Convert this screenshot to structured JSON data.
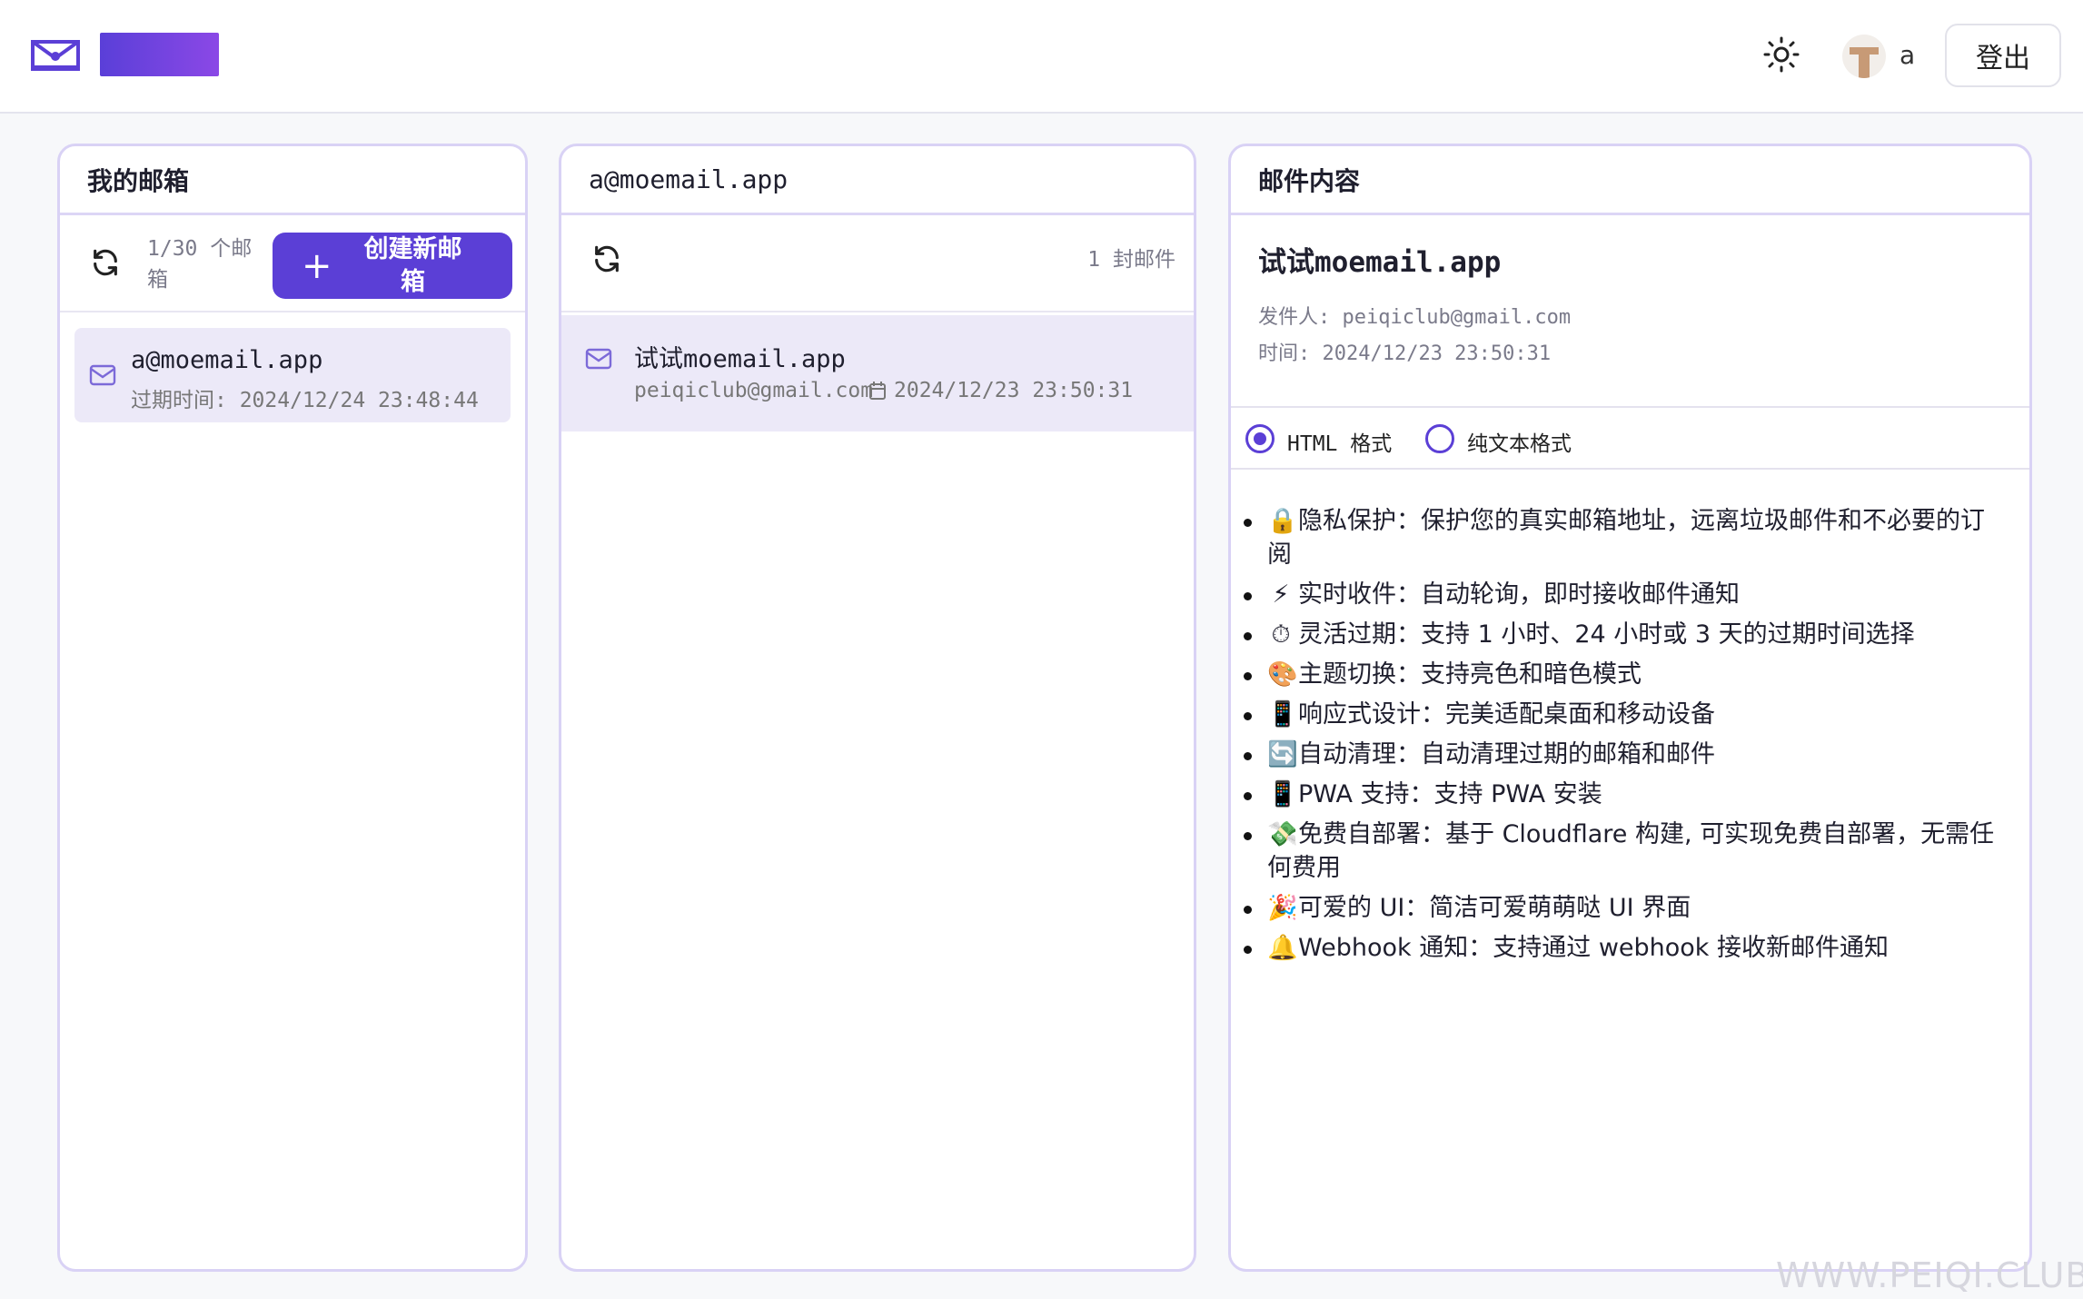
{
  "header": {
    "user_name": "a",
    "logout_label": "登出"
  },
  "mailboxes_panel": {
    "title": "我的邮箱",
    "count_text": "1/30 个邮箱",
    "create_button_label": "创建新邮箱",
    "items": [
      {
        "address": "a@moemail.app",
        "expires": "过期时间: 2024/12/24 23:48:44"
      }
    ]
  },
  "messages_panel": {
    "title": "a@moemail.app",
    "count_text": "1 封邮件",
    "items": [
      {
        "subject": "试试moemail.app",
        "from": "peiqiclub@gmail.com",
        "time": "2024/12/23 23:50:31"
      }
    ]
  },
  "content_panel": {
    "title": "邮件内容",
    "subject": "试试moemail.app",
    "from_line": "发件人: peiqiclub@gmail.com",
    "time_line": "时间: 2024/12/23 23:50:31",
    "format_html_label": "HTML 格式",
    "format_text_label": "纯文本格式",
    "selected_format": "HTML 格式",
    "features": [
      {
        "icon": "lock-icon",
        "emoji": "🔒",
        "text": "隐私保护：保护您的真实邮箱地址，远离垃圾邮件和不必要的订阅"
      },
      {
        "icon": "lightning-icon",
        "emoji": "⚡",
        "text": "实时收件：自动轮询，即时接收邮件通知"
      },
      {
        "icon": "stopwatch-icon",
        "emoji": "⏱",
        "text": "灵活过期：支持 1 小时、24 小时或 3 天的过期时间选择"
      },
      {
        "icon": "palette-icon",
        "emoji": "🎨",
        "text": "主题切换：支持亮色和暗色模式"
      },
      {
        "icon": "phone-icon",
        "emoji": "📱",
        "text": "响应式设计：完美适配桌面和移动设备"
      },
      {
        "icon": "refresh-arrows-icon",
        "emoji": "🔄",
        "text": "自动清理：自动清理过期的邮箱和邮件"
      },
      {
        "icon": "phone-icon",
        "emoji": "📱",
        "text": "PWA 支持：支持 PWA 安装"
      },
      {
        "icon": "money-icon",
        "emoji": "💸",
        "text": "免费自部署：基于 Cloudflare 构建, 可实现免费自部署，无需任何费用"
      },
      {
        "icon": "party-popper-icon",
        "emoji": "🎉",
        "text": "可爱的 UI：简洁可爱萌萌哒 UI 界面"
      },
      {
        "icon": "bell-icon",
        "emoji": "🔔",
        "text": "Webhook 通知：支持通过 webhook 接收新邮件通知"
      }
    ]
  },
  "watermark": "WWW.PEIQI.CLUB",
  "colors": {
    "accent": "#5b3fd6",
    "panel_border": "#d9d2f5",
    "selected_bg": "#ece9f8"
  }
}
